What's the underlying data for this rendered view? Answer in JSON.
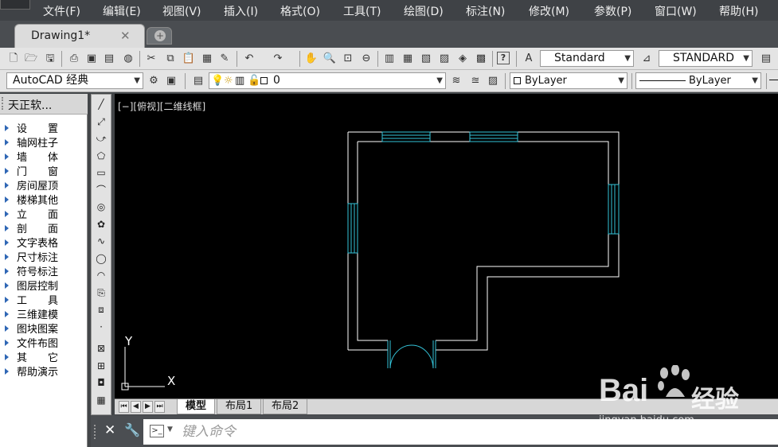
{
  "menubar": {
    "items": [
      "文件(F)",
      "编辑(E)",
      "视图(V)",
      "插入(I)",
      "格式(O)",
      "工具(T)",
      "绘图(D)",
      "标注(N)",
      "修改(M)",
      "参数(P)",
      "窗口(W)",
      "帮助(H)"
    ]
  },
  "tabs": {
    "active_label": "Drawing1*",
    "close_glyph": "✕",
    "new_tab_glyph": "+"
  },
  "toolbar": {
    "text_style": "Standard",
    "dim_style": "STANDARD",
    "workspace": "AutoCAD 经典",
    "layer": "0",
    "color": "ByLayer",
    "linetype": "ByLayer"
  },
  "palette": {
    "title": "天正软...",
    "items": [
      "设　　置",
      "轴网柱子",
      "墙　　体",
      "门　　窗",
      "房间屋顶",
      "楼梯其他",
      "立　　面",
      "剖　　面",
      "文字表格",
      "尺寸标注",
      "符号标注",
      "图层控制",
      "工　　具",
      "三维建模",
      "图块图案",
      "文件布图",
      "其　　它",
      "帮助演示"
    ]
  },
  "canvas": {
    "view_label": "[−][俯视][二维线框]",
    "ucs_x_label": "X",
    "ucs_y_label": "Y",
    "colors": {
      "background": "#000000",
      "wall": "#ffffff",
      "window": "#34c3d8",
      "door": "#34c3d8"
    }
  },
  "layout_tabs": {
    "items": [
      "模型",
      "布局1",
      "布局2"
    ],
    "active": "模型"
  },
  "command_line": {
    "placeholder": "键入命令"
  },
  "watermark": {
    "brand": "Bai",
    "brand_suffix": "经验",
    "url": "jingyan.baidu.com"
  },
  "icons": {
    "toolbar1": [
      "new-icon",
      "open-icon",
      "save-icon",
      "print-icon",
      "preview-icon",
      "publish-icon",
      "3d-dwf-icon",
      "cut-icon",
      "copy-icon",
      "paste-icon",
      "match-properties-icon",
      "block-editor-icon",
      "undo-icon",
      "redo-icon",
      "pan-icon",
      "zoom-realtime-icon",
      "zoom-window-icon",
      "zoom-previous-icon",
      "properties-icon",
      "design-center-icon",
      "tool-palettes-icon",
      "sheet-set-icon",
      "markup-icon",
      "calculator-icon",
      "help-icon",
      "text-style-icon",
      "dim-style-icon",
      "table-style-icon"
    ],
    "drawbar": [
      "line-icon",
      "construction-line-icon",
      "polyline-icon",
      "polygon-icon",
      "rectangle-icon",
      "arc-icon",
      "circle-icon",
      "revcloud-icon",
      "spline-icon",
      "ellipse-icon",
      "ellipse-arc-icon",
      "insert-block-icon",
      "make-block-icon",
      "point-icon",
      "hatch-icon",
      "gradient-icon",
      "region-icon",
      "table-icon"
    ]
  }
}
